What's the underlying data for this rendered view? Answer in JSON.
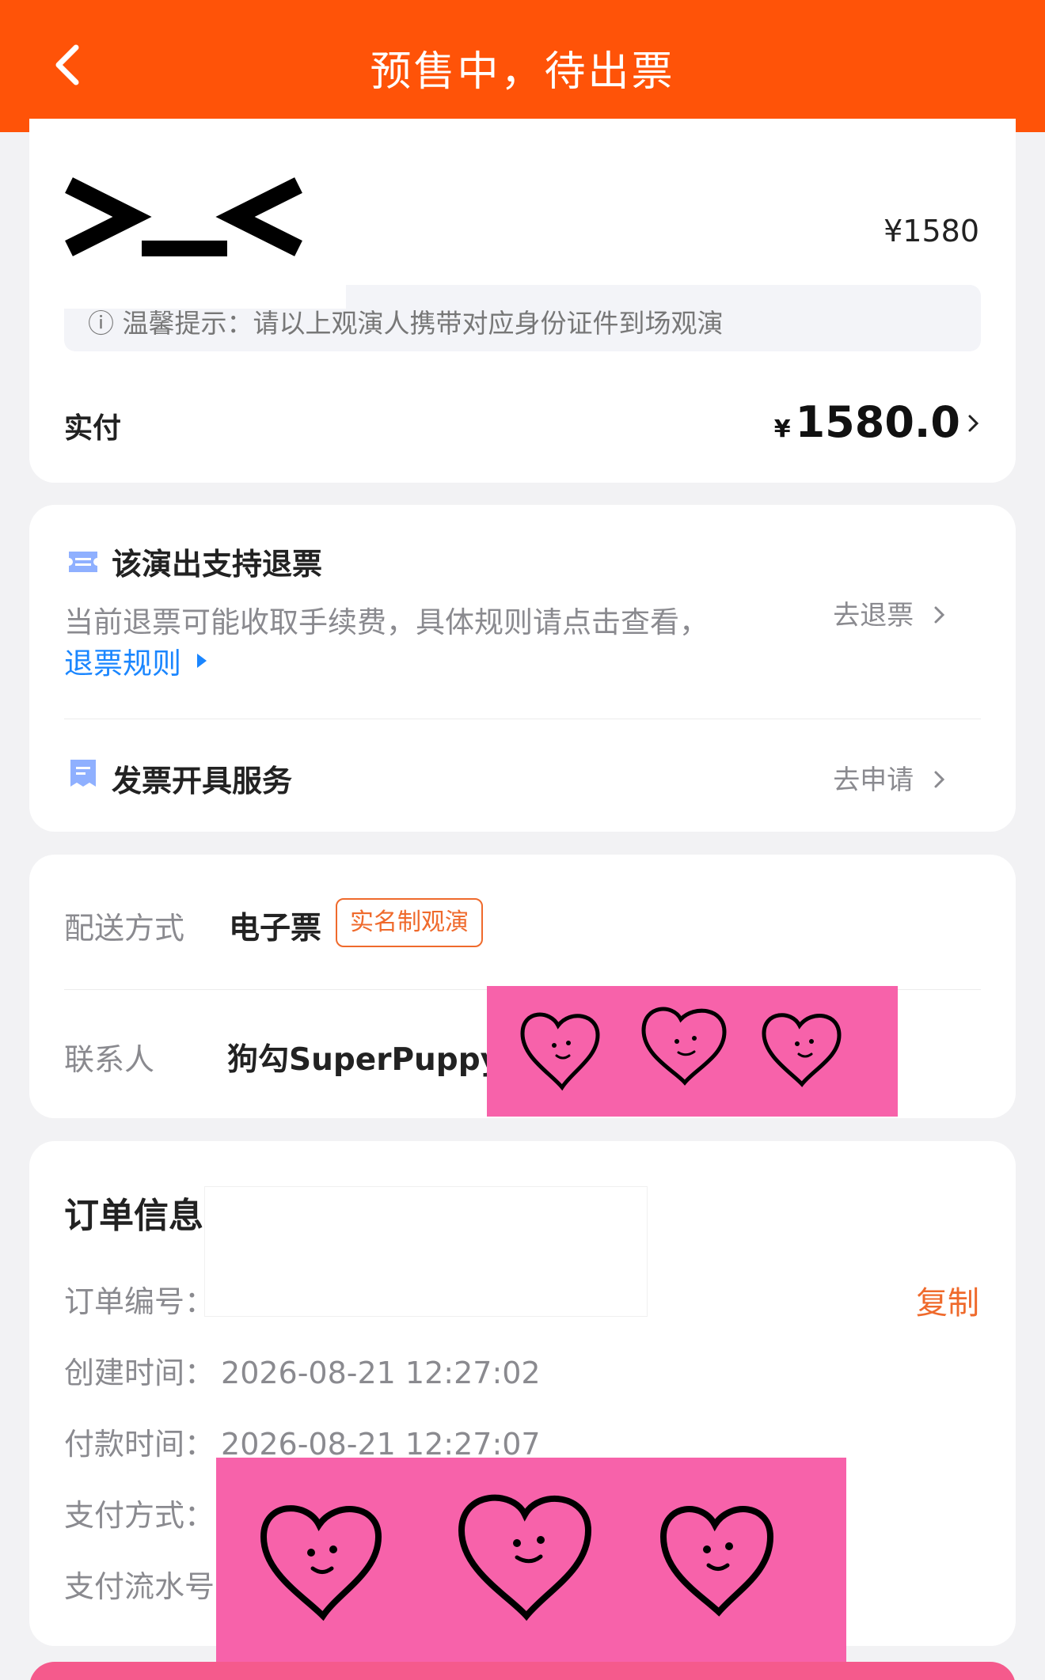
{
  "header": {
    "title": "预售中，待出票",
    "back_icon": "chevron-left-icon",
    "background": "#ff5308"
  },
  "ticket": {
    "price": "¥1580",
    "notice": "ⓘ 温馨提示：请以上观演人携带对应身份证件到场观演",
    "paid_label": "实付",
    "paid_currency": "¥",
    "paid_amount": "1580.0"
  },
  "refund": {
    "title": "该演出支持退票",
    "description": "当前退票可能收取手续费，具体规则请点击查看，",
    "rules_link": "退票规则",
    "action": "去退票"
  },
  "invoice": {
    "title": "发票开具服务",
    "action": "去申请"
  },
  "delivery": {
    "label": "配送方式",
    "value": "电子票",
    "badge": "实名制观演",
    "contact_label": "联系人",
    "contact_value": "狗勾SuperPuppy"
  },
  "order": {
    "title": "订单信息",
    "copy": "复制",
    "rows": [
      {
        "label": "订单编号：",
        "value": ""
      },
      {
        "label": "创建时间：",
        "value": "2026-08-21 12:27:02"
      },
      {
        "label": "付款时间：",
        "value": "2026-08-21 12:27:07"
      },
      {
        "label": "支付方式：",
        "value": ""
      },
      {
        "label": "支付流水号",
        "value": ""
      }
    ]
  },
  "colors": {
    "accent": "#ff5308",
    "link": "#1a86ff",
    "badge": "#ef6a2c",
    "sticker": "#f762aa"
  }
}
